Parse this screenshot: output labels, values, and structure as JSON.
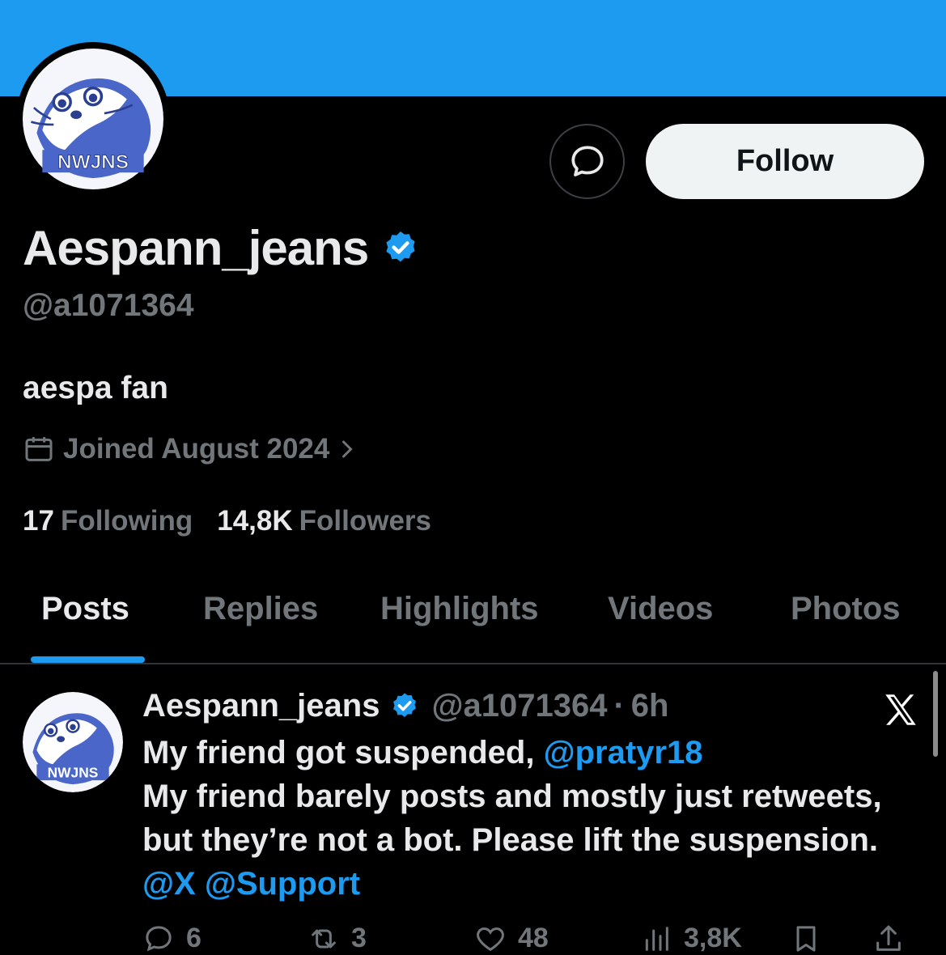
{
  "profile": {
    "display_name": "Aespann_jeans",
    "verified_icon": "verified-badge-icon",
    "handle": "@a1071364",
    "bio": "aespa fan",
    "joined": "Joined August 2024",
    "following_count": "17",
    "following_label": "Following",
    "followers_count": "14,8K",
    "followers_label": "Followers",
    "avatar_text": "NWJNS"
  },
  "buttons": {
    "message_icon": "message-icon",
    "follow_label": "Follow"
  },
  "tabs": [
    {
      "label": "Posts",
      "active": true
    },
    {
      "label": "Replies",
      "active": false
    },
    {
      "label": "Highlights",
      "active": false
    },
    {
      "label": "Videos",
      "active": false
    },
    {
      "label": "Photos",
      "active": false
    }
  ],
  "post": {
    "author": "Aespann_jeans",
    "handle": "@a1071364",
    "separator": "·",
    "time": "6h",
    "text_part1": "My friend got suspended, ",
    "mention1": "@pratyr18",
    "text_part2": "My friend barely posts and mostly just retweets, but they’re not a bot. Please lift the suspension. ",
    "mention2": "@X",
    "mention3": "@Support",
    "actions": {
      "replies": "6",
      "reposts": "3",
      "likes": "48",
      "views": "3,8K"
    }
  },
  "colors": {
    "accent": "#1d9bf0",
    "background": "#000000",
    "text_primary": "#e7e9ea",
    "text_secondary": "#71767b"
  }
}
